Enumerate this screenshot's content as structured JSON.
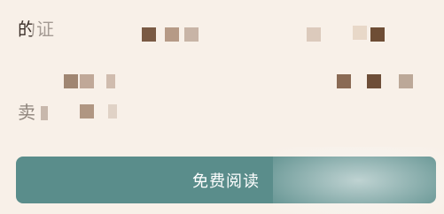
{
  "preview": {
    "line1_text": "的证",
    "line3_text": "卖"
  },
  "read_button": {
    "label": "免费阅读"
  }
}
